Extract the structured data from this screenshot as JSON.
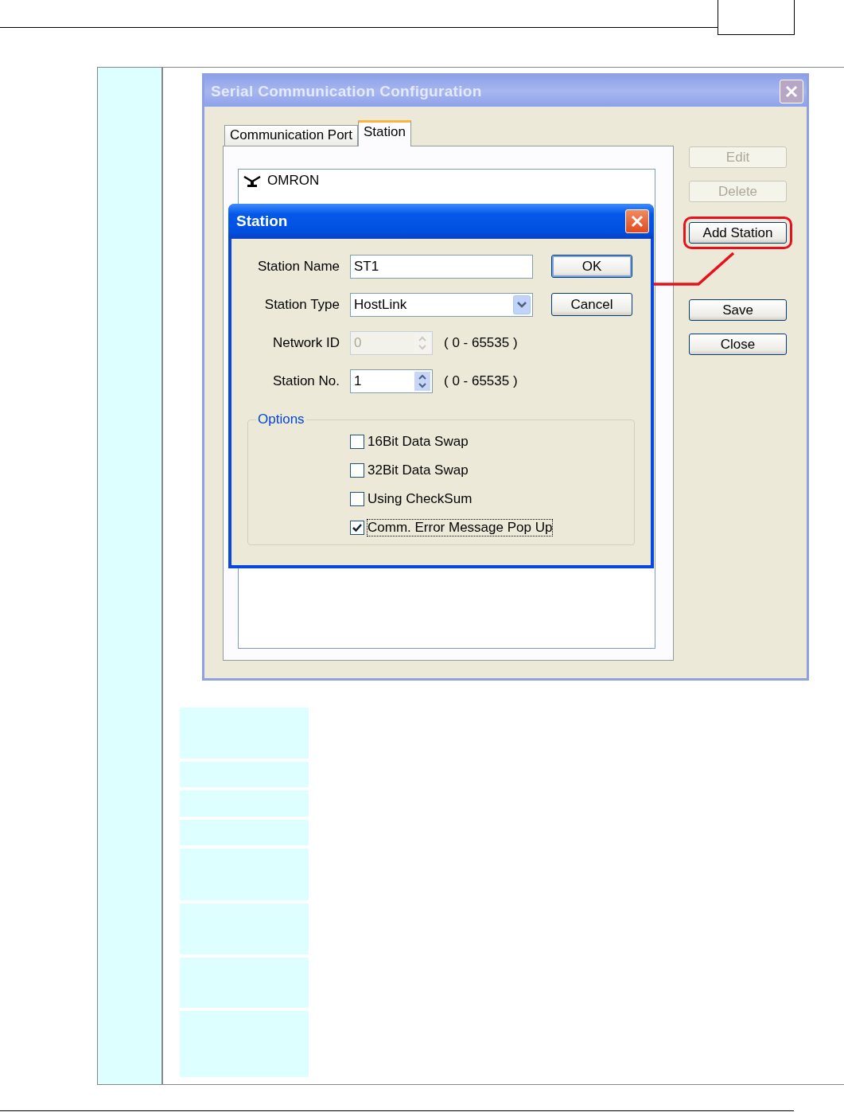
{
  "window": {
    "title": "Serial Communication Configuration",
    "active": false
  },
  "tabs": [
    {
      "label": "Communication Port",
      "selected": false
    },
    {
      "label": "Station",
      "selected": true
    }
  ],
  "station_list": [
    {
      "label": "OMRON"
    }
  ],
  "side_buttons": [
    {
      "label": "Edit",
      "disabled": true,
      "annotated": false
    },
    {
      "label": "Delete",
      "disabled": true,
      "annotated": false
    },
    {
      "label": "Add Station",
      "disabled": false,
      "annotated": true
    },
    {
      "label": "Save",
      "disabled": false,
      "annotated": false
    },
    {
      "label": "Close",
      "disabled": false,
      "annotated": false
    }
  ],
  "dialog": {
    "title": "Station",
    "fields": [
      {
        "kind": "text",
        "label": "Station Name",
        "value": "ST1"
      },
      {
        "kind": "select",
        "label": "Station Type",
        "value": "HostLink"
      },
      {
        "kind": "spin",
        "label": "Network ID",
        "value": "0",
        "disabled": true,
        "range": "( 0 - 65535 )"
      },
      {
        "kind": "spin",
        "label": "Station No.",
        "value": "1",
        "disabled": false,
        "range": "( 0 - 65535 )"
      }
    ],
    "buttons": [
      {
        "label": "OK",
        "default": true
      },
      {
        "label": "Cancel",
        "default": false
      }
    ],
    "options": {
      "title": "Options",
      "items": [
        {
          "label": "16Bit Data Swap",
          "checked": false,
          "focused": false
        },
        {
          "label": "32Bit Data Swap",
          "checked": false,
          "focused": false
        },
        {
          "label": "Using CheckSum",
          "checked": false,
          "focused": false
        },
        {
          "label": "Comm. Error Message Pop Up",
          "checked": true,
          "focused": true
        }
      ]
    }
  }
}
